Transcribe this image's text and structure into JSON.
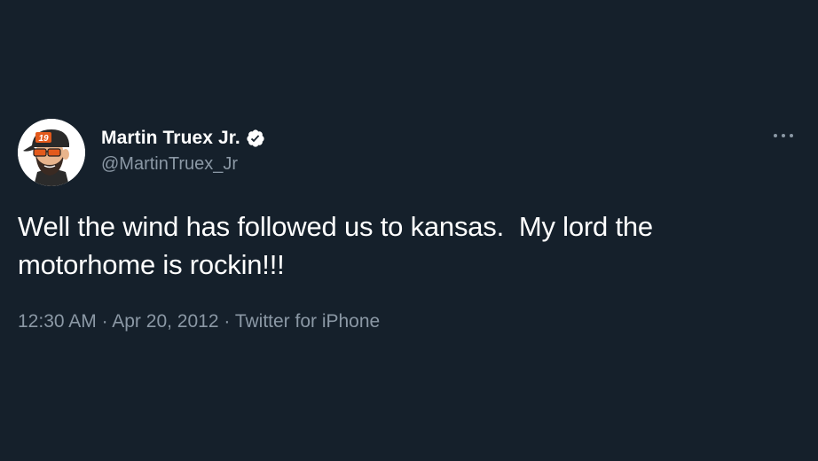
{
  "tweet": {
    "author": {
      "display_name": "Martin Truex Jr.",
      "handle": "@MartinTruex_Jr",
      "verified": true,
      "avatar_icon": "avatar-cartoon-icon",
      "avatar_cap_number": "19"
    },
    "text": "Well the wind has followed us to kansas.  My lord the\nmotorhome is rockin!!!",
    "time": "12:30 AM",
    "date": "Apr 20, 2012",
    "source": "Twitter for iPhone",
    "separator": " · "
  },
  "icons": {
    "verified": "verified-badge-icon",
    "more": "more-options-icon"
  },
  "colors": {
    "background": "#15202b",
    "primary_text": "#ffffff",
    "secondary_text": "#8b98a5",
    "accent_cap": "#e35a1c"
  }
}
